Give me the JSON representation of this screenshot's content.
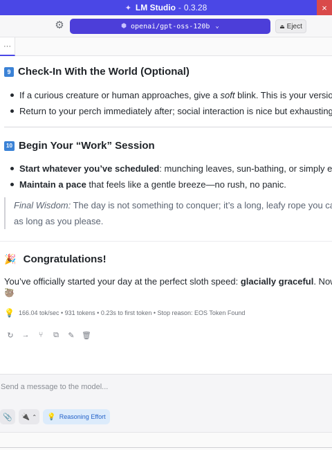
{
  "window": {
    "app_name": "LM Studio",
    "separator": "-",
    "version": "0.3.28",
    "close_glyph": "×",
    "accent_color": "#4a47e6"
  },
  "toolbar": {
    "settings_icon": "gear-icon",
    "model": "openai/gpt-oss-120b",
    "eject_label": "Eject"
  },
  "tabs": {
    "more_label": "···"
  },
  "message": {
    "section9": {
      "number": "9",
      "title": "Check-In With the World (Optional)",
      "bullet1_pre": "If a curious creature or human approaches, give a ",
      "bullet1_em": "soft",
      "bullet1_post": " blink. This is your version of “he",
      "bullet2": "Return to your perch immediately after; social interaction is nice but exhausting."
    },
    "section10": {
      "number": "10",
      "title": "Begin Your “Work” Session",
      "bullet1_bold": "Start whatever you’ve scheduled",
      "bullet1_rest": ": munching leaves, sun-bathing, or simply existing.",
      "bullet2_bold": "Maintain a pace",
      "bullet2_rest": " that feels like a gentle breeze—no rush, no panic."
    },
    "quote": {
      "label": "Final Wisdom:",
      "line1_rest": " The day is not something to conquer; it’s a long, leafy rope you can hang",
      "line2": "as long as you please."
    },
    "congrats": {
      "emoji": "🎉",
      "title": "Congratulations!"
    },
    "closing": {
      "pre": "You’ve officially started your day at the perfect sloth speed: ",
      "bold": "glacially graceful",
      "post": ". Now go for",
      "emoji": "🦥"
    },
    "stats": "166.04 tok/sec • 931 tokens • 0.23s to first token • Stop reason: EOS Token Found"
  },
  "composer": {
    "placeholder": "Send a message to the model...",
    "reasoning_label": "Reasoning Effort"
  }
}
